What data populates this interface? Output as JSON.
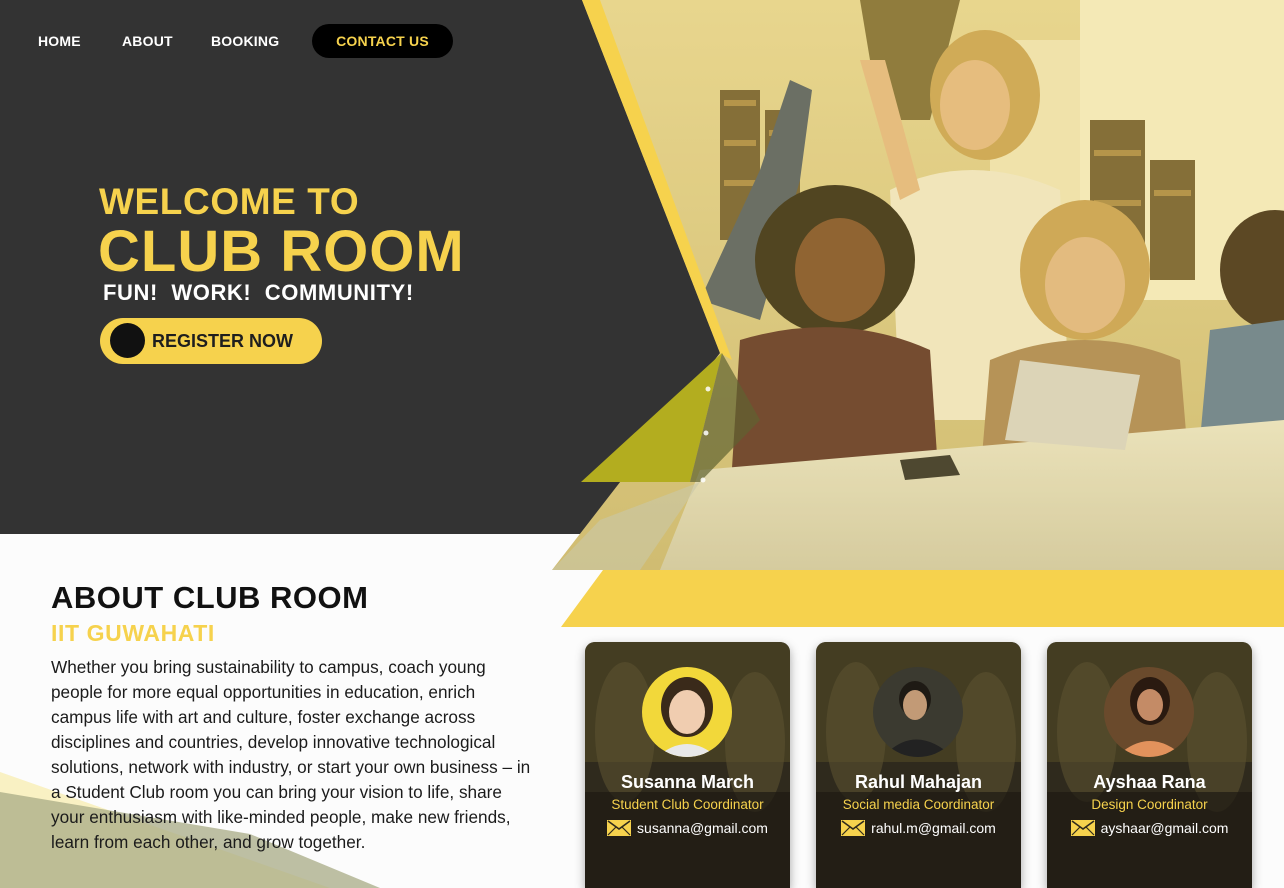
{
  "nav": {
    "home": "HOME",
    "about": "ABOUT",
    "booking": "BOOKING",
    "contact": "CONTACT US"
  },
  "hero": {
    "welcome": "WELCOME TO",
    "title": "CLUB ROOM",
    "tagline": "FUN!  WORK!  COMMUNITY!",
    "register_label": "REGISTER NOW"
  },
  "about": {
    "title": "ABOUT CLUB ROOM",
    "subtitle": "IIT GUWAHATI",
    "body": "Whether you bring sustainability to campus, coach young people for more equal opportunities in education, enrich campus life with art and culture, foster exchange across disciplines and countries, develop innovative technological solutions, network with industry, or start your own business – in a Student Club room you can bring your vision to life, share your enthusiasm with like-minded people, make new friends, learn from each other, and grow together."
  },
  "team": [
    {
      "name": "Susanna March",
      "role": "Student Club Coordinator",
      "email": "susanna@gmail.com"
    },
    {
      "name": "Rahul Mahajan",
      "role": "Social media Coordinator",
      "email": "rahul.m@gmail.com"
    },
    {
      "name": "Ayshaa Rana",
      "role": "Design Coordinator",
      "email": "ayshaar@gmail.com"
    }
  ],
  "colors": {
    "accent": "#f6d24d",
    "dark": "#333333",
    "black": "#000000",
    "white": "#ffffff"
  },
  "icons": {
    "mail": "envelope-icon"
  }
}
